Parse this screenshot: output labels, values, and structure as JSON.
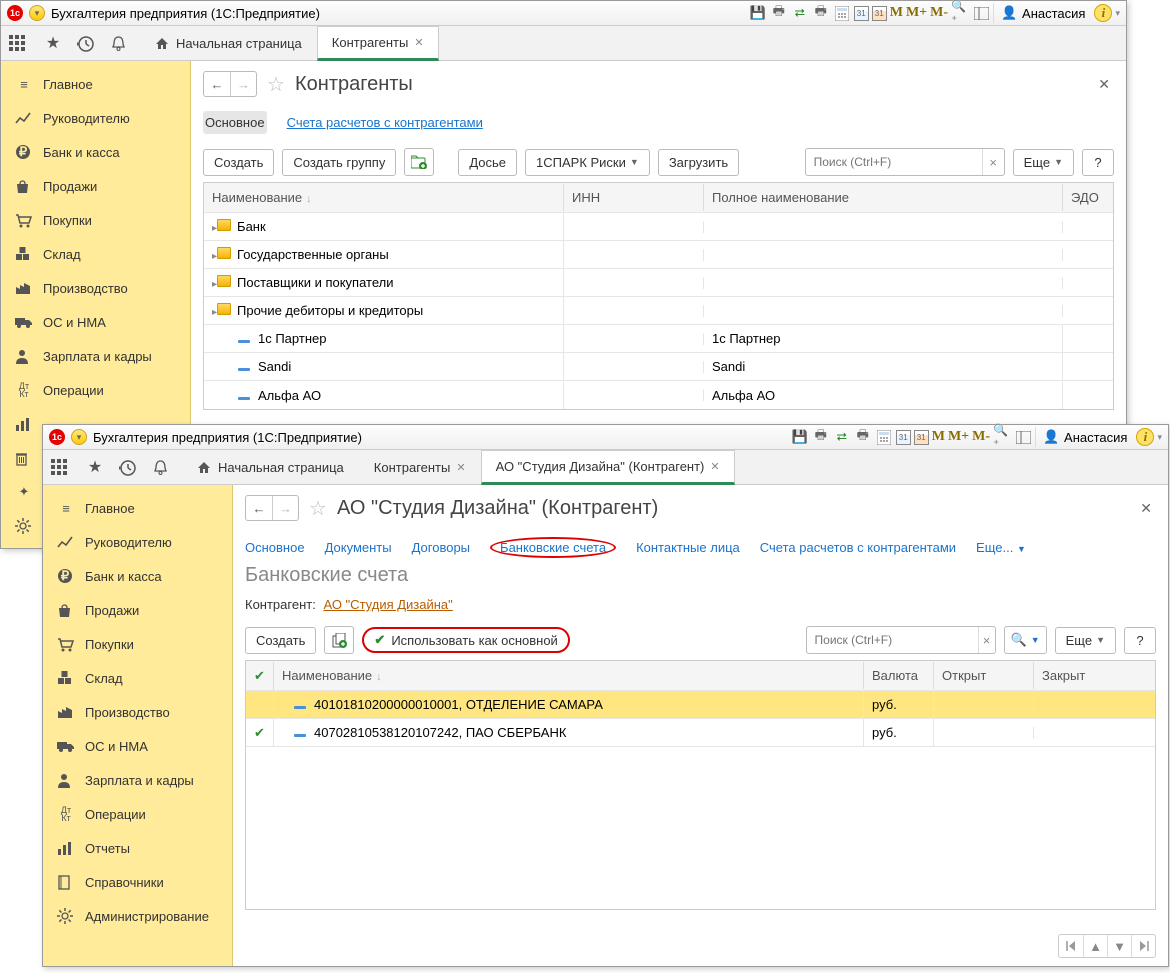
{
  "app_title": "Бухгалтерия предприятия  (1С:Предприятие)",
  "user_name": "Анастасия",
  "m_keys": [
    "M",
    "M+",
    "M-"
  ],
  "topbar_home": "Начальная страница",
  "win1": {
    "tabs": [
      "Контрагенты"
    ],
    "page_title": "Контрагенты",
    "subtabs": {
      "main": "Основное",
      "accounts": "Счета расчетов с контрагентами"
    },
    "toolbar": {
      "create": "Создать",
      "create_group": "Создать группу",
      "dossier": "Досье",
      "spark": "1СПАРК Риски",
      "load": "Загрузить",
      "more": "Еще",
      "help": "?"
    },
    "search_placeholder": "Поиск (Ctrl+F)",
    "columns": {
      "name": "Наименование",
      "inn": "ИНН",
      "full": "Полное наименование",
      "edo": "ЭДО"
    },
    "folders": [
      "Банк",
      "Государственные органы",
      "Поставщики и покупатели",
      "Прочие дебиторы и кредиторы"
    ],
    "rows": [
      {
        "name": "1с Партнер",
        "full": "1с Партнер"
      },
      {
        "name": "Sandi",
        "full": "Sandi"
      },
      {
        "name": "Альфа АО",
        "full": "Альфа АО"
      }
    ],
    "sidebar": [
      "Главное",
      "Руководителю",
      "Банк и касса",
      "Продажи",
      "Покупки",
      "Склад",
      "Производство",
      "ОС и НМА",
      "Зарплата и кадры",
      "Операции"
    ]
  },
  "win2": {
    "tabs": [
      "Контрагенты",
      "АО \"Студия Дизайна\" (Контрагент)"
    ],
    "active_tab": 1,
    "page_title": "АО \"Студия Дизайна\" (Контрагент)",
    "links": {
      "main": "Основное",
      "docs": "Документы",
      "contracts": "Договоры",
      "bank": "Банковские счета",
      "contacts": "Контактные лица",
      "accounts": "Счета расчетов с контрагентами",
      "more": "Еще..."
    },
    "section_title": "Банковские счета",
    "field_label": "Контрагент:",
    "field_value": "АО \"Студия Дизайна\"",
    "toolbar": {
      "create": "Создать",
      "set_main": "Использовать как основной",
      "more": "Еще",
      "help": "?"
    },
    "search_placeholder": "Поиск (Ctrl+F)",
    "columns": {
      "name": "Наименование",
      "currency": "Валюта",
      "opened": "Открыт",
      "closed": "Закрыт"
    },
    "rows": [
      {
        "main": false,
        "name": "40101810200000010001, ОТДЕЛЕНИЕ САМАРА",
        "currency": "руб.",
        "sel": true
      },
      {
        "main": true,
        "name": "40702810538120107242, ПАО СБЕРБАНК",
        "currency": "руб.",
        "sel": false
      }
    ],
    "sidebar": [
      "Главное",
      "Руководителю",
      "Банк и касса",
      "Продажи",
      "Покупки",
      "Склад",
      "Производство",
      "ОС и НМА",
      "Зарплата и кадры",
      "Операции",
      "Отчеты",
      "Справочники",
      "Администрирование"
    ]
  },
  "sidebar_extra_icons": [
    "report-icon",
    "trash-icon",
    "star-icon",
    "gear-icon"
  ]
}
